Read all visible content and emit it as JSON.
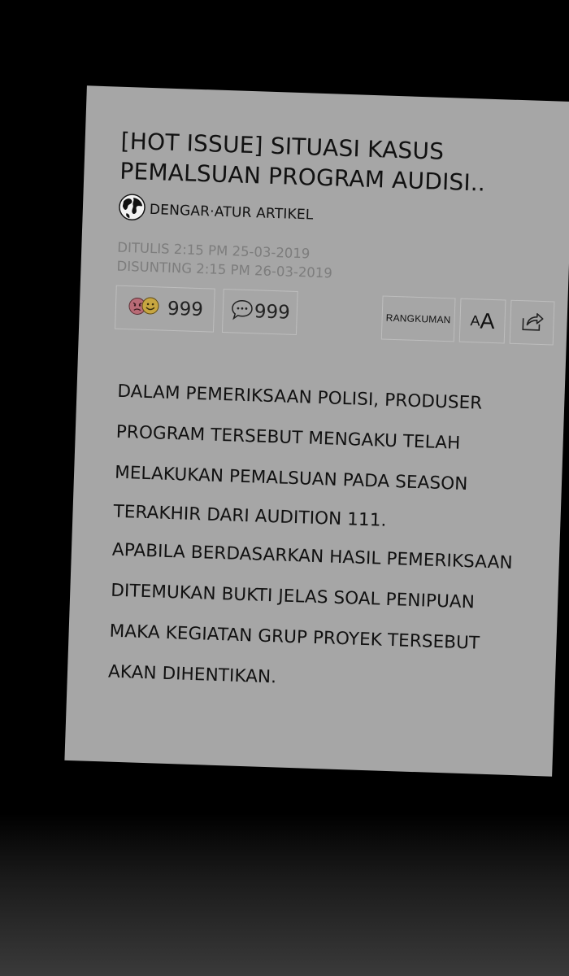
{
  "article": {
    "title_line1": "[HOT ISSUE] SITUASI KASUS",
    "title_line2": "PEMALSUAN PROGRAM AUDISI..",
    "listen_label": "DENGAR·ATUR ARTIKEL",
    "written": "DITULIS 2:15 PM 25-03-2019",
    "edited": "DISUNTING 2:15 PM 26-03-2019",
    "body": [
      "DALAM PEMERIKSAAN POLISI, PRODUSER",
      "PROGRAM TERSEBUT MENGAKU TELAH",
      "MELAKUKAN PEMALSUAN PADA SEASON",
      "TERAKHIR DARI AUDITION 111.",
      "APABILA BERDASARKAN HASIL PEMERIKSAAN",
      "DITEMUKAN BUKTI JELAS SOAL PENIPUAN",
      "MAKA KEGIATAN GRUP PROYEK TERSEBUT",
      "AKAN DIHENTIKAN."
    ]
  },
  "toolbar": {
    "reaction_count": "999",
    "comment_count": "999",
    "summary_label": "RANGKUMAN",
    "font_small": "A",
    "font_big": "A"
  },
  "icons": {
    "listen": "globe-icon",
    "reaction": "emoji-reactions-icon",
    "comment": "speech-bubble-icon",
    "share": "share-icon"
  },
  "colors": {
    "card": "#a6a6a6",
    "meta_text": "#7d7d7d",
    "angry_face": "#b86b76",
    "smile_face": "#c7a641",
    "background": "#000000"
  }
}
